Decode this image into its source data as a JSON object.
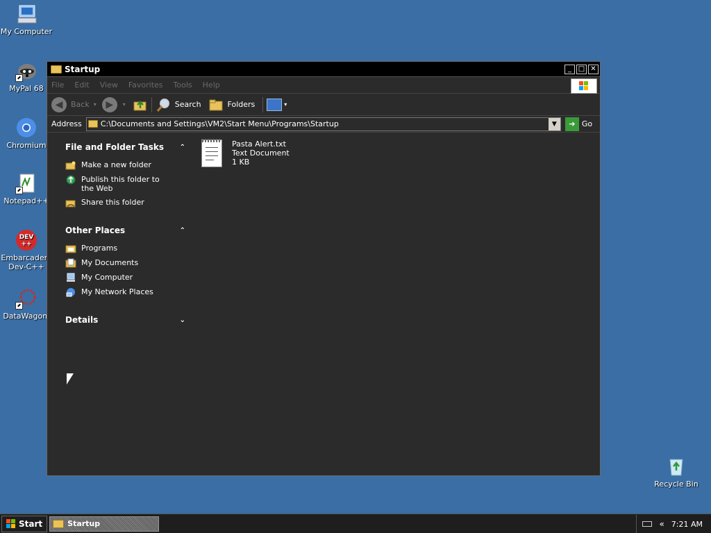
{
  "desktop": {
    "icons": [
      {
        "label": "My Computer",
        "icon": "my-computer-icon"
      },
      {
        "label": "MyPal 68",
        "icon": "mypal-raccoon-icon"
      },
      {
        "label": "Chromium",
        "icon": "chromium-icon"
      },
      {
        "label": "Notepad++",
        "icon": "notepadpp-icon"
      },
      {
        "label": "Embarcadero Dev-C++",
        "icon": "devcpp-icon"
      },
      {
        "label": "DataWagon.",
        "icon": "datawagon-icon"
      },
      {
        "label": "Recycle Bin",
        "icon": "recycle-bin-icon"
      }
    ]
  },
  "window": {
    "title": "Startup",
    "menu": [
      "File",
      "Edit",
      "View",
      "Favorites",
      "Tools",
      "Help"
    ],
    "toolbar": {
      "back_label": "Back",
      "search_label": "Search",
      "folders_label": "Folders"
    },
    "address": {
      "label": "Address",
      "value": "C:\\Documents and Settings\\VM2\\Start Menu\\Programs\\Startup",
      "go_label": "Go"
    },
    "tasks_panel": {
      "title": "File and Folder Tasks",
      "items": [
        {
          "label": "Make a new folder",
          "icon": "new-folder-icon"
        },
        {
          "label": "Publish this folder to the Web",
          "icon": "publish-web-icon"
        },
        {
          "label": "Share this folder",
          "icon": "share-folder-icon"
        }
      ]
    },
    "places_panel": {
      "title": "Other Places",
      "items": [
        {
          "label": "Programs",
          "icon": "programs-folder-icon"
        },
        {
          "label": "My Documents",
          "icon": "my-documents-icon"
        },
        {
          "label": "My Computer",
          "icon": "my-computer-icon"
        },
        {
          "label": "My Network Places",
          "icon": "network-places-icon"
        }
      ]
    },
    "details_panel": {
      "title": "Details"
    },
    "files": [
      {
        "name": "Pasta Alert.txt",
        "type": "Text Document",
        "size": "1 KB",
        "icon": "text-document-icon"
      }
    ]
  },
  "taskbar": {
    "start_label": "Start",
    "task_label": "Startup",
    "tray_chevron": "«",
    "clock": "7:21 AM"
  },
  "colors": {
    "desktop": "#3a6ea5",
    "window_bg": "#2b2b2b",
    "titlebar": "#000000",
    "taskbar": "#1e1e1e"
  }
}
